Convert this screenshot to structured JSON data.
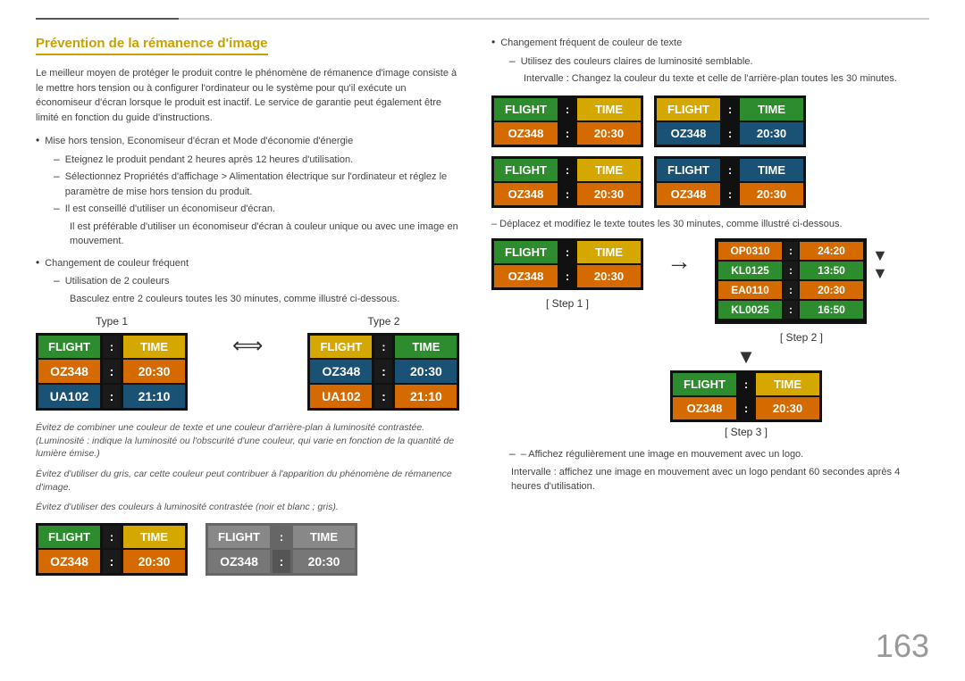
{
  "page": {
    "number": "163"
  },
  "header": {
    "title": "Prévention de la rémanence d'image"
  },
  "left": {
    "intro": "Le meilleur moyen de protéger le produit contre le phénomène de rémanence d'image consiste à le mettre hors tension ou à configurer l'ordinateur ou le système pour qu'il exécute un économiseur d'écran lorsque le produit est inactif. Le service de garantie peut également être limité en fonction du guide d'instructions.",
    "bullet1": "Mise hors tension, Economiseur d'écran et Mode d'économie d'énergie",
    "dash1": "Eteignez le produit pendant 2 heures après 12 heures d'utilisation.",
    "dash2": "Sélectionnez Propriétés d'affichage > Alimentation électrique sur l'ordinateur et réglez le paramètre de mise hors tension du produit.",
    "dash3": "Il est conseillé d'utiliser un économiseur d'écran.",
    "dash4": "Il est préférable d'utiliser un économiseur d'écran à couleur unique ou avec une image en mouvement.",
    "bullet2": "Changement de couleur fréquent",
    "dash5": "Utilisation de 2 couleurs",
    "dash6": "Basculez entre 2 couleurs toutes les 30 minutes, comme illustré ci-dessous.",
    "type1_label": "Type 1",
    "type2_label": "Type 2",
    "italic1": "Évitez de combiner une couleur de texte et une couleur d'arrière-plan à luminosité contrastée. (Luminosité : indique la luminosité ou l'obscurité d'une couleur, qui varie en fonction de la quantité de lumière émise.)",
    "italic2": "Évitez d'utiliser du gris, car cette couleur peut contribuer à l'apparition du phénomène de rémanence d'image.",
    "italic3": "Évitez d'utiliser des couleurs à luminosité contrastée (noir et blanc ; gris).",
    "board1": {
      "header_left": "FLIGHT",
      "header_colon": ":",
      "header_right": "TIME",
      "row1_left": "OZ348",
      "row1_colon": ":",
      "row1_right": "20:30",
      "row2_left": "UA102",
      "row2_colon": ":",
      "row2_right": "21:10"
    },
    "board2": {
      "header_left": "FLIGHT",
      "header_colon": ":",
      "header_right": "TIME",
      "row1_left": "OZ348",
      "row1_colon": ":",
      "row1_right": "20:30",
      "row2_left": "UA102",
      "row2_colon": ":",
      "row2_right": "21:10"
    },
    "bottom_board1": {
      "header_left": "FLIGHT",
      "header_colon": ":",
      "header_right": "TIME",
      "row1_left": "OZ348",
      "row1_colon": ":",
      "row1_right": "20:30"
    },
    "bottom_board2": {
      "header_left": "FLIGHT",
      "header_colon": ":",
      "header_right": "TIME",
      "row1_left": "OZ348",
      "row1_colon": ":",
      "row1_right": "20:30"
    }
  },
  "right": {
    "bullet1": "Changement fréquent de couleur de texte",
    "sub1": "Utilisez des couleurs claires de luminosité semblable.",
    "sub2": "Intervalle : Changez la couleur du texte et celle de l'arrière-plan toutes les 30 minutes.",
    "board_tl": {
      "header_left": "FLIGHT",
      "header_colon": ":",
      "header_right": "TIME",
      "row1_left": "OZ348",
      "row1_colon": ":",
      "row1_right": "20:30"
    },
    "board_tr": {
      "header_left": "FLIGHT",
      "header_colon": ":",
      "header_right": "TIME",
      "row1_left": "OZ348",
      "row1_colon": ":",
      "row1_right": "20:30"
    },
    "board_ml": {
      "header_left": "FLIGHT",
      "header_colon": ":",
      "header_right": "TIME",
      "row1_left": "OZ348",
      "row1_colon": ":",
      "row1_right": "20:30"
    },
    "board_mr": {
      "header_left": "FLIGHT",
      "header_colon": ":",
      "header_right": "TIME",
      "row1_left": "OZ348",
      "row1_colon": ":",
      "row1_right": "20:30"
    },
    "sub3": "– Déplacez et modifiez le texte toutes les 30 minutes, comme illustré ci-dessous.",
    "step1_label": "[ Step 1 ]",
    "step2_label": "[ Step 2 ]",
    "step3_label": "[ Step 3 ]",
    "scrolling": {
      "row1_left": "OP0310",
      "row1_colon": ":",
      "row1_right": "24:20",
      "row2_left": "KL0125",
      "row2_colon": ":",
      "row2_right": "13:50",
      "row3_left": "EA0110",
      "row3_colon": ":",
      "row3_right": "20:30",
      "row4_left": "KL0025",
      "row4_colon": ":",
      "row4_right": "16:50"
    },
    "step1_board": {
      "header_left": "FLIGHT",
      "header_colon": ":",
      "header_right": "TIME",
      "row1_left": "OZ348",
      "row1_colon": ":",
      "row1_right": "20:30"
    },
    "step3_board": {
      "header_left": "FLIGHT",
      "header_colon": ":",
      "header_right": "TIME",
      "row1_left": "OZ348",
      "row1_colon": ":",
      "row1_right": "20:30"
    },
    "bottom_note": "– Affichez régulièrement une image en mouvement avec un logo.",
    "bottom_note2": "Intervalle : affichez une image en mouvement avec un logo pendant 60 secondes après 4 heures d'utilisation."
  }
}
